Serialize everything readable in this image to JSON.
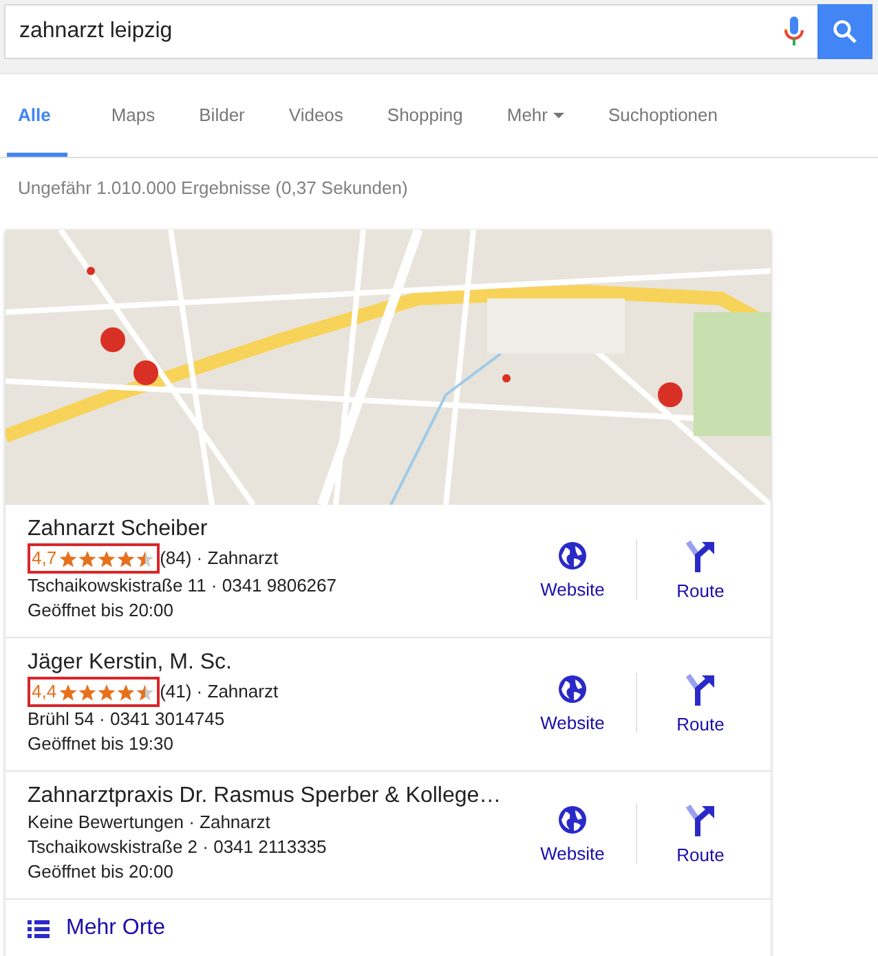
{
  "search": {
    "value": "zahnarzt leipzig"
  },
  "tabs": [
    {
      "label": "Alle",
      "selected": true,
      "dropdown": false
    },
    {
      "label": "Maps",
      "selected": false,
      "dropdown": false
    },
    {
      "label": "Bilder",
      "selected": false,
      "dropdown": false
    },
    {
      "label": "Videos",
      "selected": false,
      "dropdown": false
    },
    {
      "label": "Shopping",
      "selected": false,
      "dropdown": false
    },
    {
      "label": "Mehr",
      "selected": false,
      "dropdown": true
    },
    {
      "label": "Suchoptionen",
      "selected": false,
      "dropdown": false
    }
  ],
  "result_stats": "Ungefähr 1.010.000 Ergebnisse (0,37 Sekunden)",
  "places": [
    {
      "name": "Zahnarzt Scheiber",
      "rating": "4,7",
      "stars": 4.5,
      "highlighted": true,
      "reviews": "(84) · Zahnarzt",
      "address": "Tschaikowskistraße 11 · 0341 9806267",
      "hours": "Geöffnet bis 20:00",
      "website": "Website",
      "route": "Route"
    },
    {
      "name": "Jäger Kerstin, M. Sc.",
      "rating": "4,4",
      "stars": 4.5,
      "highlighted": true,
      "reviews": "(41) · Zahnarzt",
      "address": "Brühl 54 · 0341 3014745",
      "hours": "Geöffnet bis 19:30",
      "website": "Website",
      "route": "Route"
    },
    {
      "name": "Zahnarztpraxis Dr. Rasmus Sperber & Kollege…",
      "no_reviews": "Keine Bewertungen · Zahnarzt",
      "address": "Tschaikowskistraße 2 · 0341 2113335",
      "hours": "Geöffnet bis 20:00",
      "website": "Website",
      "route": "Route"
    }
  ],
  "more": "Mehr Orte"
}
